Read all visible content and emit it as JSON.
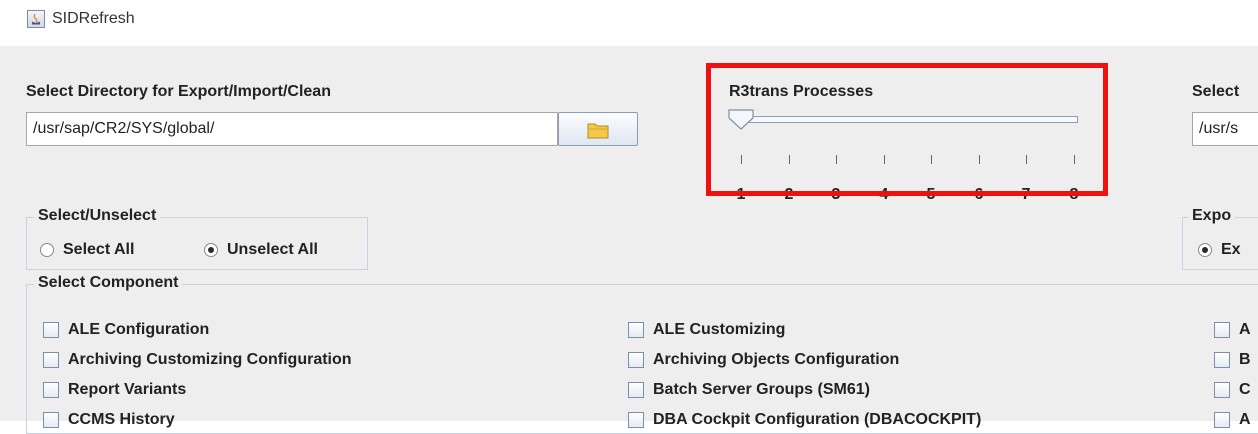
{
  "window": {
    "title": "SIDRefresh"
  },
  "export_dir": {
    "label": "Select Directory for Export/Import/Clean",
    "value": "/usr/sap/CR2/SYS/global/"
  },
  "select_unselect": {
    "title": "Select/Unselect",
    "options": [
      "Select All",
      "Unselect All"
    ],
    "selected": "Unselect All"
  },
  "r3trans": {
    "title": "R3trans Processes",
    "ticks": [
      "1",
      "2",
      "3",
      "4",
      "5",
      "6",
      "7",
      "8"
    ],
    "value": 1
  },
  "right_partial": {
    "label": "Select",
    "path": "/usr/s",
    "group_title": "Expo",
    "radio_label": "Ex"
  },
  "components": {
    "title": "Select Component",
    "col1": [
      "ALE Configuration",
      "Archiving Customizing Configuration",
      "Report Variants",
      "CCMS History"
    ],
    "col2": [
      "ALE Customizing",
      "Archiving Objects Configuration",
      "Batch Server Groups (SM61)",
      "DBA Cockpit Configuration (DBACOCKPIT)"
    ],
    "col3": [
      "A",
      "B",
      "C",
      "A"
    ]
  }
}
